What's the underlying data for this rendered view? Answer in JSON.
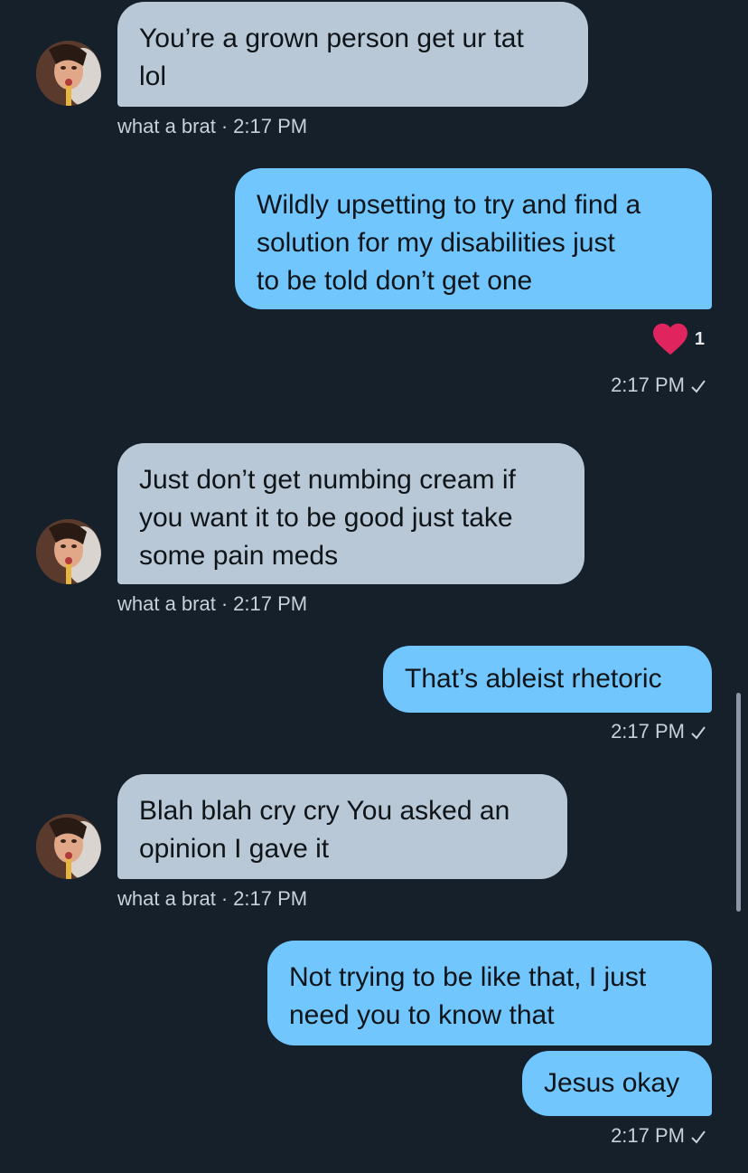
{
  "conversation": {
    "messages": [
      {
        "direction": "incoming",
        "lines": [
          "You’re a grown person get ur tat",
          "lol"
        ],
        "sender": "what a brat",
        "time": "2:17 PM"
      },
      {
        "direction": "outgoing",
        "lines": [
          "Wildly upsetting to try and find a",
          "solution for my disabilities just",
          "to be told don’t get one"
        ],
        "reaction_count": "1",
        "time": "2:17 PM"
      },
      {
        "direction": "incoming",
        "lines": [
          "Just don’t get numbing cream if",
          "you want it to be good just take",
          "some pain meds"
        ],
        "sender": "what a brat",
        "time": "2:17 PM"
      },
      {
        "direction": "outgoing",
        "lines": [
          "That’s ableist rhetoric"
        ],
        "time": "2:17 PM"
      },
      {
        "direction": "incoming",
        "lines": [
          "Blah blah cry cry You asked an",
          "opinion I gave it"
        ],
        "sender": "what a brat",
        "time": "2:17 PM"
      },
      {
        "direction": "outgoing",
        "lines": [
          "Not trying to be like that, I just",
          "need you to know that"
        ]
      },
      {
        "direction": "outgoing",
        "lines": [
          "Jesus okay"
        ],
        "time": "2:17 PM"
      }
    ]
  },
  "icons": {
    "reaction": "heart-icon",
    "sent_status": "checkmark-icon"
  },
  "colors": {
    "background": "#15202b",
    "incoming_bubble": "#b8c8d6",
    "outgoing_bubble": "#70c6fd",
    "heart": "#e0245e"
  }
}
